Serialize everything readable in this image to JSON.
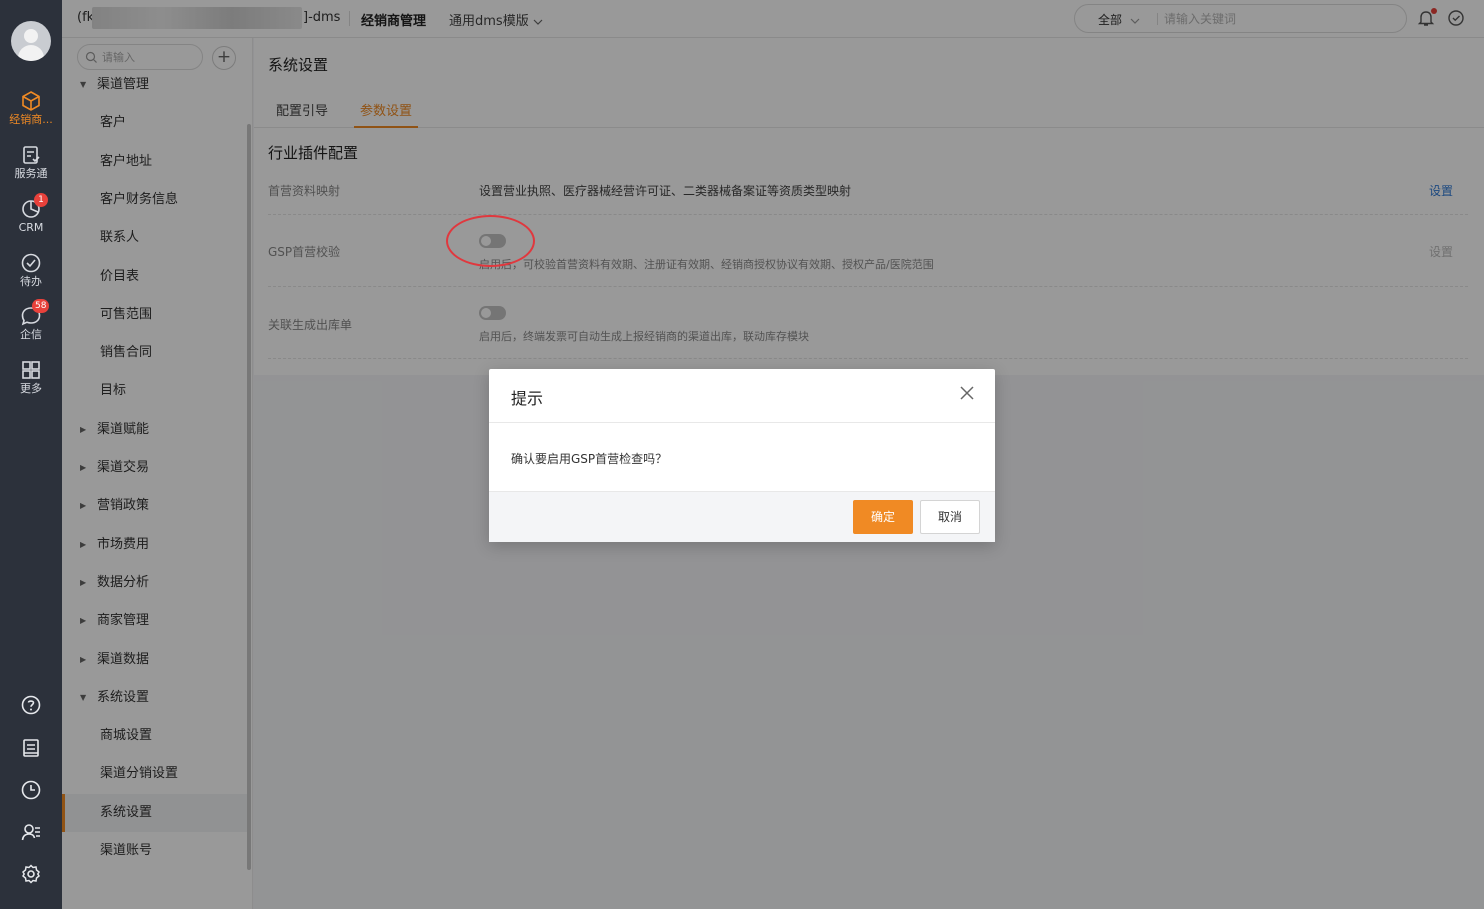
{
  "topbar": {
    "company": "(fk",
    "dms_suffix": "]-dms",
    "module": "经销商管理",
    "template": "通用dms模版",
    "search_scope": "全部",
    "search_placeholder": "请输入关键词"
  },
  "rail": {
    "items": [
      {
        "label": "经销商...",
        "icon": "cube-icon",
        "active": true
      },
      {
        "label": "服务通",
        "icon": "service-icon"
      },
      {
        "label": "CRM",
        "icon": "crm-icon",
        "badge": "1"
      },
      {
        "label": "待办",
        "icon": "check-circle-icon"
      },
      {
        "label": "企信",
        "icon": "chat-icon",
        "badge": "58"
      },
      {
        "label": "更多",
        "icon": "grid-icon"
      }
    ],
    "bottom_icons": [
      "help-icon",
      "notebook-icon",
      "clock-icon",
      "contacts-icon",
      "settings-icon"
    ]
  },
  "sidenav": {
    "search_placeholder": "请输入",
    "groups": [
      {
        "label": "渠道管理",
        "expanded": true
      },
      {
        "label": "客户"
      },
      {
        "label": "客户地址"
      },
      {
        "label": "客户财务信息"
      },
      {
        "label": "联系人"
      },
      {
        "label": "价目表"
      },
      {
        "label": "可售范围"
      },
      {
        "label": "销售合同"
      },
      {
        "label": "目标"
      },
      {
        "label": "渠道赋能"
      },
      {
        "label": "渠道交易"
      },
      {
        "label": "营销政策"
      },
      {
        "label": "市场费用"
      },
      {
        "label": "数据分析"
      },
      {
        "label": "商家管理"
      },
      {
        "label": "渠道数据"
      },
      {
        "label": "系统设置",
        "expanded": true
      },
      {
        "label": "商城设置"
      },
      {
        "label": "渠道分销设置"
      },
      {
        "label": "系统设置",
        "selected": true
      },
      {
        "label": "渠道账号"
      }
    ]
  },
  "main": {
    "page_title": "系统设置",
    "tabs": [
      {
        "label": "配置引导"
      },
      {
        "label": "参数设置",
        "active": true
      }
    ],
    "section_title": "行业插件配置",
    "rows": [
      {
        "label": "首营资料映射",
        "desc": "设置营业执照、医疗器械经营许可证、二类器械备案证等资质类型映射",
        "link": "设置"
      },
      {
        "label": "GSP首营校验",
        "desc": "启用后，可校验首营资料有效期、注册证有效期、经销商授权协议有效期、授权产品/医院范围",
        "link": "设置",
        "toggle": false
      },
      {
        "label": "关联生成出库单",
        "desc": "启用后，终端发票可自动生成上报经销商的渠道出库，联动库存模块",
        "toggle": false
      }
    ]
  },
  "modal": {
    "title": "提示",
    "message": "确认要启用GSP首营检查吗？",
    "ok": "确定",
    "cancel": "取消"
  },
  "colors": {
    "accent": "#f08a24",
    "link": "#2f7ad6",
    "rail_bg": "#2c313b",
    "highlight": "#e0383e"
  }
}
